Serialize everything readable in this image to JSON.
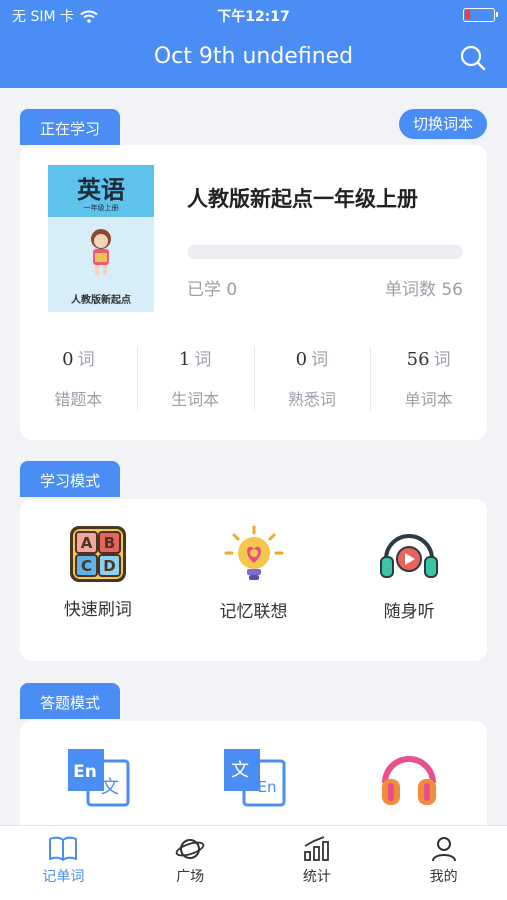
{
  "status_bar": {
    "carrier": "无 SIM 卡",
    "time": "下午12:17"
  },
  "nav": {
    "title": "Oct 9th undefined",
    "search_icon": "search-icon"
  },
  "current_study": {
    "tag": "正在学习",
    "switch_button": "切换词本",
    "book": {
      "cover_title": "英语",
      "cover_subtitle": "一年级上册",
      "cover_footer": "人教版新起点",
      "name": "人教版新起点一年级上册",
      "progress": 0,
      "learned_label": "已学",
      "learned_value": "0",
      "word_count_label": "单词数",
      "word_count_value": "56"
    },
    "stats": [
      {
        "value": "0",
        "unit": "词",
        "label": "错题本"
      },
      {
        "value": "1",
        "unit": "词",
        "label": "生词本"
      },
      {
        "value": "0",
        "unit": "词",
        "label": "熟悉词"
      },
      {
        "value": "56",
        "unit": "词",
        "label": "单词本"
      }
    ]
  },
  "study_modes": {
    "tag": "学习模式",
    "items": [
      {
        "label": "快速刷词",
        "icon": "abcd-blocks-icon"
      },
      {
        "label": "记忆联想",
        "icon": "lightbulb-icon"
      },
      {
        "label": "随身听",
        "icon": "headphones-icon"
      }
    ]
  },
  "answer_modes": {
    "tag": "答题模式",
    "items": [
      {
        "icon": "en-to-zh-icon"
      },
      {
        "icon": "zh-to-en-icon"
      },
      {
        "icon": "headphones-music-icon"
      }
    ]
  },
  "tabbar": {
    "items": [
      {
        "label": "记单词",
        "icon": "book-icon",
        "active": true
      },
      {
        "label": "广场",
        "icon": "planet-icon",
        "active": false
      },
      {
        "label": "统计",
        "icon": "bar-chart-icon",
        "active": false
      },
      {
        "label": "我的",
        "icon": "user-icon",
        "active": false
      }
    ]
  },
  "colors": {
    "accent": "#4a8df5",
    "background": "#f2f3f7",
    "card": "#ffffff",
    "muted_text": "#9aa0a8"
  }
}
